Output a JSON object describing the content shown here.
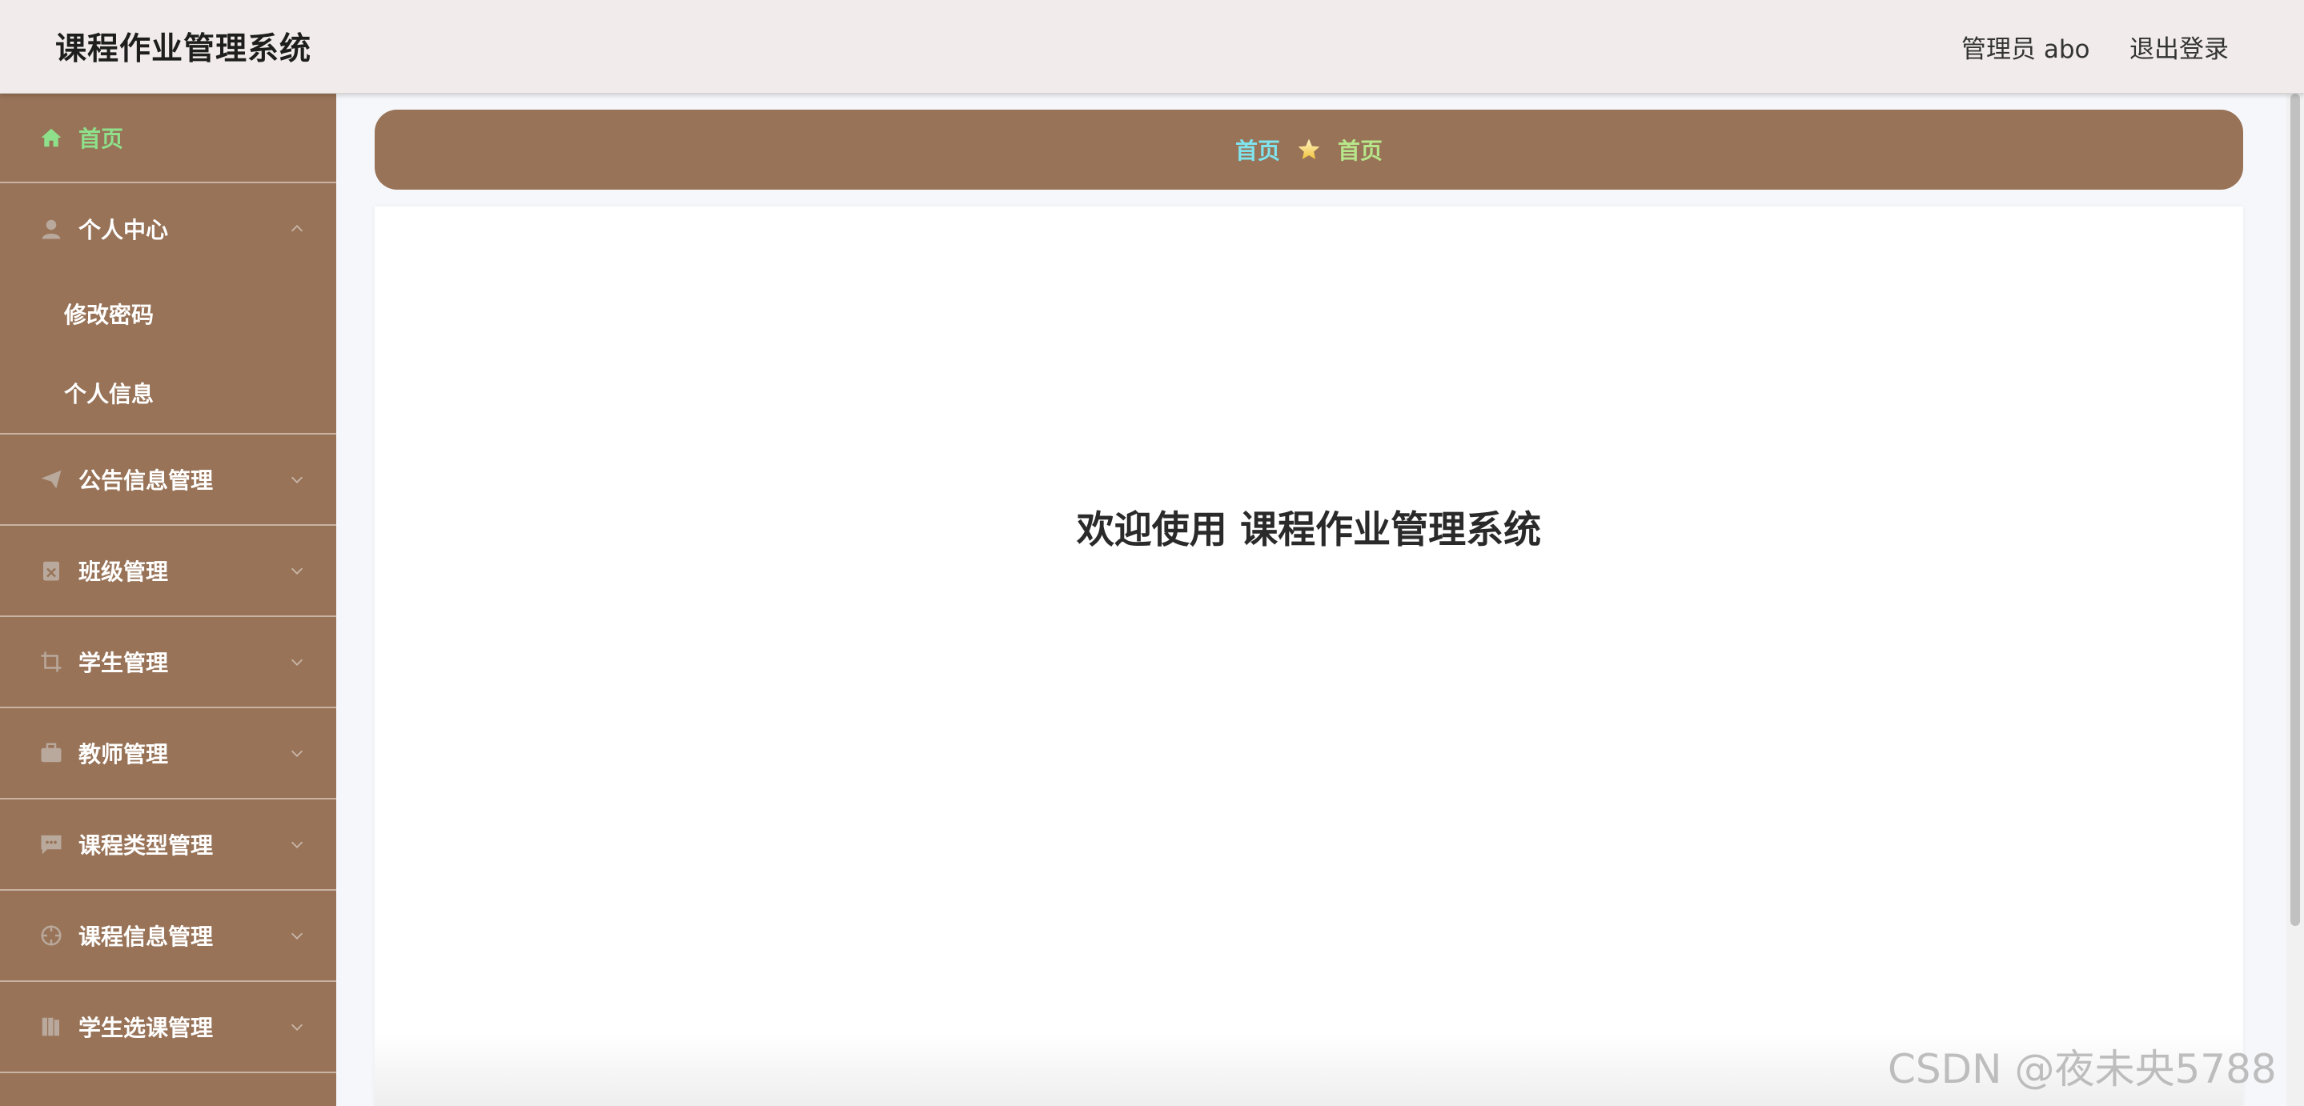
{
  "header": {
    "title": "课程作业管理系统",
    "user": "管理员 abo",
    "logout": "退出登录"
  },
  "sidebar": {
    "items": [
      {
        "label": "首页",
        "icon": "home-icon",
        "active": true
      },
      {
        "label": "个人中心",
        "icon": "user-icon",
        "expanded": true,
        "children": [
          {
            "label": "修改密码"
          },
          {
            "label": "个人信息"
          }
        ]
      },
      {
        "label": "公告信息管理",
        "icon": "send-icon"
      },
      {
        "label": "班级管理",
        "icon": "clipboard-icon"
      },
      {
        "label": "学生管理",
        "icon": "crop-icon"
      },
      {
        "label": "教师管理",
        "icon": "briefcase-icon"
      },
      {
        "label": "课程类型管理",
        "icon": "chat-icon"
      },
      {
        "label": "课程信息管理",
        "icon": "target-icon"
      },
      {
        "label": "学生选课管理",
        "icon": "book-icon"
      }
    ]
  },
  "breadcrumb": {
    "items": [
      "首页",
      "首页"
    ],
    "separator_icon": "star-icon"
  },
  "main": {
    "welcome": "欢迎使用 课程作业管理系统"
  },
  "watermark": "CSDN @夜未央5788",
  "colors": {
    "sidebar_bg": "#987358",
    "header_bg": "#f1eceb",
    "active_item": "#8ee08a",
    "crumb_first": "#7fe4ee",
    "crumb_second": "#b7e68a"
  }
}
